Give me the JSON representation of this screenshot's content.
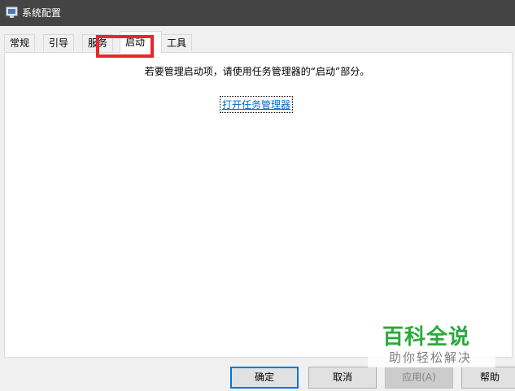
{
  "window": {
    "title": "系统配置"
  },
  "tabs": [
    {
      "label": "常规"
    },
    {
      "label": "引导"
    },
    {
      "label": "服务"
    },
    {
      "label": "启动"
    },
    {
      "label": "工具"
    }
  ],
  "startup": {
    "message": "若要管理启动项，请使用任务管理器的“启动”部分。",
    "open_task_manager_link": "打开任务管理器"
  },
  "buttons": {
    "ok": "确定",
    "cancel": "取消",
    "apply": "应用(A)",
    "help": "帮助"
  },
  "watermark": {
    "title": "百科全说",
    "subtitle": "助你轻松解决"
  },
  "colors": {
    "titlebar": "#444444",
    "highlight": "#e8262c",
    "link": "#0066cc",
    "watermark_green": "#2aaa3a"
  }
}
